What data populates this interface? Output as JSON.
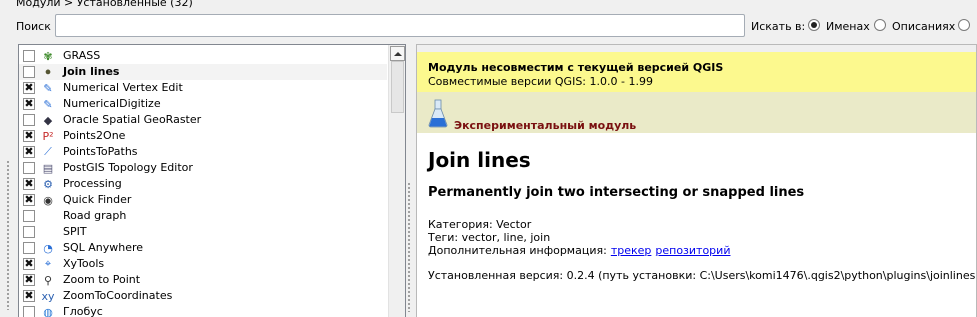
{
  "breadcrumb": "Модули > Установленные (32)",
  "search": {
    "label": "Поиск",
    "value": ""
  },
  "search_in": {
    "label": "Искать в:",
    "options": [
      {
        "label": "Именах",
        "checked": true
      },
      {
        "label": "Описаниях",
        "checked": false
      }
    ]
  },
  "plugins": [
    {
      "name": "GRASS",
      "checked": false,
      "icon": "grass-icon"
    },
    {
      "name": "Join lines",
      "checked": false,
      "icon": "join-lines-icon",
      "selected": true
    },
    {
      "name": "Numerical Vertex Edit",
      "checked": true,
      "icon": "vertex-edit-icon"
    },
    {
      "name": "NumericalDigitize",
      "checked": true,
      "icon": "digitize-icon"
    },
    {
      "name": "Oracle Spatial GeoRaster",
      "checked": false,
      "icon": "oracle-icon"
    },
    {
      "name": "Points2One",
      "checked": true,
      "icon": "points2one-icon"
    },
    {
      "name": "PointsToPaths",
      "checked": true,
      "icon": "points-to-paths-icon"
    },
    {
      "name": "PostGIS Topology Editor",
      "checked": false,
      "icon": "postgis-icon"
    },
    {
      "name": "Processing",
      "checked": true,
      "icon": "gear-icon"
    },
    {
      "name": "Quick Finder",
      "checked": true,
      "icon": "eye-icon"
    },
    {
      "name": "Road graph",
      "checked": false,
      "icon": "road-icon"
    },
    {
      "name": "SPIT",
      "checked": false,
      "icon": "spit-icon"
    },
    {
      "name": "SQL Anywhere",
      "checked": false,
      "icon": "sql-icon"
    },
    {
      "name": "XyTools",
      "checked": true,
      "icon": "xytools-icon"
    },
    {
      "name": "Zoom to Point",
      "checked": true,
      "icon": "magnifier-icon"
    },
    {
      "name": "ZoomToCoordinates",
      "checked": true,
      "icon": "xy-icon"
    },
    {
      "name": "Глобус",
      "checked": false,
      "icon": "globe-icon"
    }
  ],
  "details": {
    "warning_title": "Модуль несовместим с текущей версией QGIS",
    "warning_sub": "Совместимые версии QGIS: 1.0.0 - 1.99",
    "experimental": "Экспериментальный модуль",
    "title": "Join lines",
    "description": "Permanently join two intersecting or snapped lines",
    "category": "Категория: Vector",
    "tags": "Теги: vector, line, join",
    "more_info_label": "Дополнительная информация:",
    "link_tracker": "трекер",
    "link_repo": "репозиторий",
    "installed": "Установленная версия: 0.2.4 (путь установки: C:\\Users\\komi1476\\.qgis2\\python\\plugins\\joinlines)"
  }
}
